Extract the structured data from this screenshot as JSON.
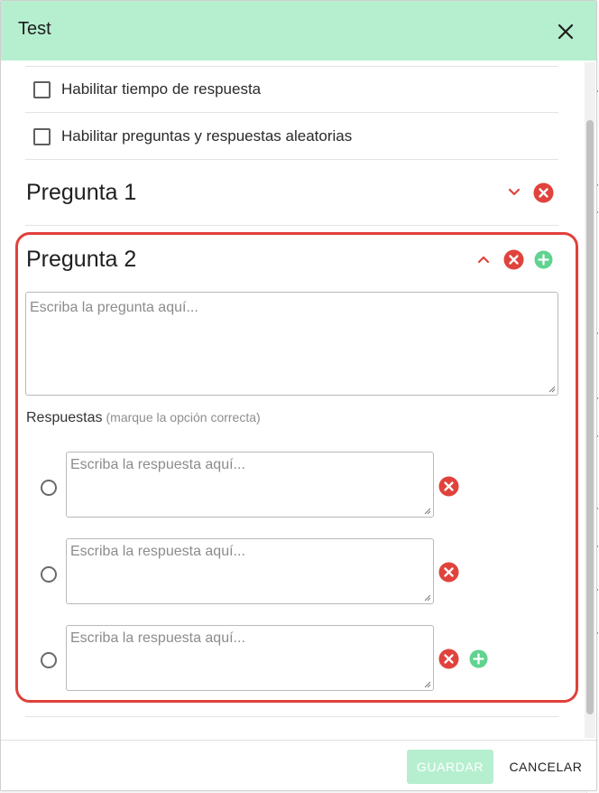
{
  "dialog": {
    "title": "Test",
    "close_icon": "close-icon"
  },
  "options": [
    {
      "label": "Habilitar tiempo de respuesta",
      "checked": false
    },
    {
      "label": "Habilitar preguntas y respuestas aleatorias",
      "checked": false
    }
  ],
  "questions": [
    {
      "title": "Pregunta 1",
      "expanded": false,
      "icons": [
        "chevron-down-icon",
        "remove-circle-icon"
      ]
    },
    {
      "title": "Pregunta 2",
      "expanded": true,
      "icons": [
        "chevron-up-icon",
        "remove-circle-icon",
        "add-circle-icon"
      ],
      "question_placeholder": "Escriba la pregunta aquí...",
      "answers_label": "Respuestas",
      "answers_hint": "(marque la opción correcta)",
      "answers": [
        {
          "placeholder": "Escriba la respuesta aquí...",
          "selected": false
        },
        {
          "placeholder": "Escriba la respuesta aquí...",
          "selected": false
        },
        {
          "placeholder": "Escriba la respuesta aquí...",
          "selected": false
        }
      ]
    }
  ],
  "footer": {
    "save_label": "GUARDAR",
    "cancel_label": "CANCELAR"
  },
  "colors": {
    "header_bg": "#b6efcf",
    "remove_red": "#e0433c",
    "add_green": "#5fd38f",
    "highlight_red": "#e1403a"
  }
}
